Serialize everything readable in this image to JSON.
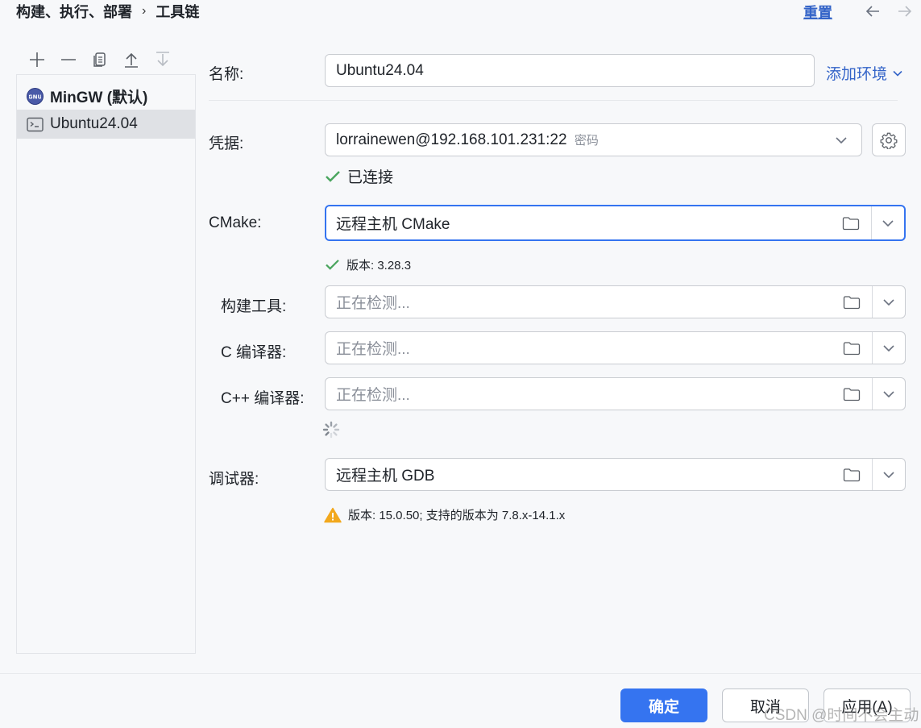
{
  "breadcrumb": {
    "parent": "构建、执行、部署",
    "separator": "›",
    "current": "工具链"
  },
  "header": {
    "reset_label": "重置",
    "back_icon": "arrow-left-icon",
    "forward_icon": "arrow-right-icon"
  },
  "toolbar": {
    "icons": [
      "plus-icon",
      "minus-icon",
      "copy-icon",
      "move-up-icon",
      "move-down-icon"
    ]
  },
  "toolchains": [
    {
      "name": "MinGW (默认)",
      "icon": "gnu-icon",
      "selected": false
    },
    {
      "name": "Ubuntu24.04",
      "icon": "terminal-icon",
      "selected": true
    }
  ],
  "form": {
    "name_label": "名称:",
    "name_value": "Ubuntu24.04",
    "add_env_label": "添加环境",
    "credentials_label": "凭据:",
    "credentials_value": "lorrainewen@192.168.101.231:22",
    "credentials_suffix": "密码",
    "connected_text": "已连接",
    "cmake_label": "CMake:",
    "cmake_value": "远程主机 CMake",
    "cmake_version": "版本: 3.28.3",
    "build_tool_label": "构建工具:",
    "build_tool_placeholder": "正在检测...",
    "c_compiler_label": "C 编译器:",
    "c_compiler_placeholder": "正在检测...",
    "cpp_compiler_label": "C++ 编译器:",
    "cpp_compiler_placeholder": "正在检测...",
    "debugger_label": "调试器:",
    "debugger_value": "远程主机 GDB",
    "debugger_warning": "版本: 15.0.50; 支持的版本为 7.8.x-14.1.x"
  },
  "buttons": {
    "ok": "确定",
    "cancel": "取消",
    "apply": "应用(A)"
  },
  "watermark": "CSDN @时间不会主动",
  "colors": {
    "accent": "#3574f0",
    "success": "#4aa55e",
    "warning": "#f2a81d",
    "link": "#3464c8"
  }
}
